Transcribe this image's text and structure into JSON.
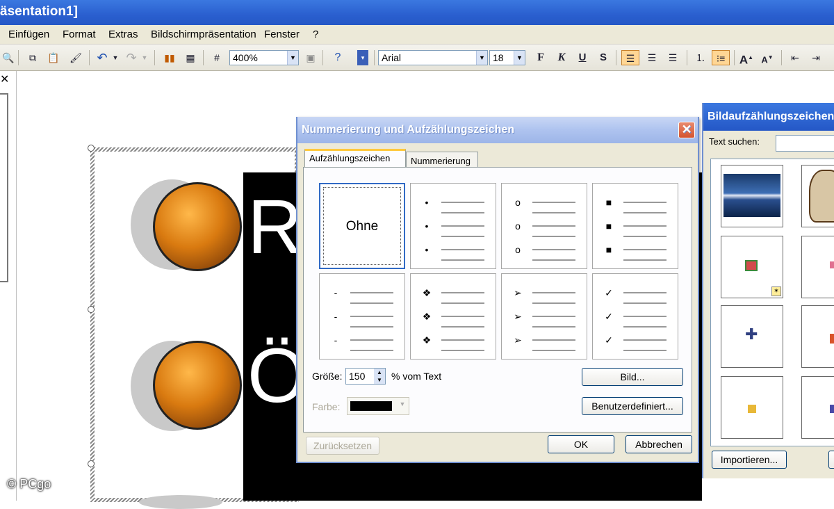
{
  "window": {
    "title": "äsentation1]"
  },
  "menu": [
    "Einfügen",
    "Format",
    "Extras",
    "Bildschirmpräsentation",
    "Fenster",
    "?"
  ],
  "toolbar": {
    "zoom": "400%",
    "font": "Arial",
    "font_size": "18",
    "bold": "F",
    "italic": "K",
    "underline": "U",
    "shadow": "S"
  },
  "slide": {
    "letters": [
      "R",
      "Ö"
    ]
  },
  "dialog": {
    "title": "Nummerierung und Aufzählungszeichen",
    "close": "✕",
    "tabs": [
      "Aufzählungszeichen",
      "Nummerierung"
    ],
    "bullets": [
      {
        "label": "Ohne",
        "glyph": ""
      },
      {
        "label": "",
        "glyph": "•"
      },
      {
        "label": "",
        "glyph": "o"
      },
      {
        "label": "",
        "glyph": "■"
      },
      {
        "label": "",
        "glyph": "-"
      },
      {
        "label": "",
        "glyph": "❖"
      },
      {
        "label": "",
        "glyph": "➢"
      },
      {
        "label": "",
        "glyph": "✓"
      }
    ],
    "size_label": "Größe:",
    "size_value": "150",
    "size_unit": "% vom Text",
    "color_label": "Farbe:",
    "picture_button": "Bild...",
    "custom_button": "Benutzerdefiniert...",
    "reset_button": "Zurücksetzen",
    "ok_button": "OK",
    "cancel_button": "Abbrechen"
  },
  "picture_panel": {
    "title": "Bildaufzählungszeichen",
    "search_label": "Text suchen:",
    "import_button": "Importieren..."
  },
  "watermark": "© PCgo"
}
